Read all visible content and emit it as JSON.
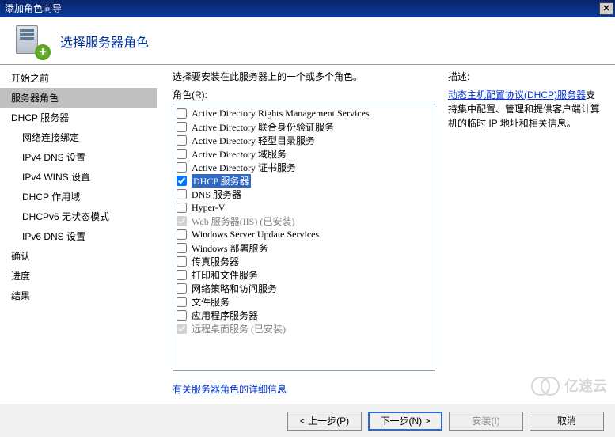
{
  "window": {
    "title": "添加角色向导"
  },
  "header": {
    "title": "选择服务器角色"
  },
  "sidebar": {
    "items": [
      {
        "label": "开始之前",
        "active": false,
        "sub": false
      },
      {
        "label": "服务器角色",
        "active": true,
        "sub": false
      },
      {
        "label": "DHCP 服务器",
        "active": false,
        "sub": false
      },
      {
        "label": "网络连接绑定",
        "active": false,
        "sub": true
      },
      {
        "label": "IPv4 DNS 设置",
        "active": false,
        "sub": true
      },
      {
        "label": "IPv4 WINS 设置",
        "active": false,
        "sub": true
      },
      {
        "label": "DHCP 作用域",
        "active": false,
        "sub": true
      },
      {
        "label": "DHCPv6 无状态模式",
        "active": false,
        "sub": true
      },
      {
        "label": "IPv6 DNS 设置",
        "active": false,
        "sub": true
      },
      {
        "label": "确认",
        "active": false,
        "sub": false
      },
      {
        "label": "进度",
        "active": false,
        "sub": false
      },
      {
        "label": "结果",
        "active": false,
        "sub": false
      }
    ]
  },
  "main": {
    "intro": "选择要安装在此服务器上的一个或多个角色。",
    "roles_label": "角色(R):",
    "roles": [
      {
        "label": "Active Directory Rights Management Services",
        "checked": false,
        "disabled": false,
        "selected": false
      },
      {
        "label": "Active Directory 联合身份验证服务",
        "checked": false,
        "disabled": false,
        "selected": false
      },
      {
        "label": "Active Directory 轻型目录服务",
        "checked": false,
        "disabled": false,
        "selected": false
      },
      {
        "label": "Active Directory 域服务",
        "checked": false,
        "disabled": false,
        "selected": false
      },
      {
        "label": "Active Directory 证书服务",
        "checked": false,
        "disabled": false,
        "selected": false
      },
      {
        "label": "DHCP 服务器",
        "checked": true,
        "disabled": false,
        "selected": true
      },
      {
        "label": "DNS 服务器",
        "checked": false,
        "disabled": false,
        "selected": false
      },
      {
        "label": "Hyper-V",
        "checked": false,
        "disabled": false,
        "selected": false
      },
      {
        "label": "Web 服务器(IIS)  (已安装)",
        "checked": true,
        "disabled": true,
        "selected": false
      },
      {
        "label": "Windows Server Update Services",
        "checked": false,
        "disabled": false,
        "selected": false
      },
      {
        "label": "Windows 部署服务",
        "checked": false,
        "disabled": false,
        "selected": false
      },
      {
        "label": "传真服务器",
        "checked": false,
        "disabled": false,
        "selected": false
      },
      {
        "label": "打印和文件服务",
        "checked": false,
        "disabled": false,
        "selected": false
      },
      {
        "label": "网络策略和访问服务",
        "checked": false,
        "disabled": false,
        "selected": false
      },
      {
        "label": "文件服务",
        "checked": false,
        "disabled": false,
        "selected": false
      },
      {
        "label": "应用程序服务器",
        "checked": false,
        "disabled": false,
        "selected": false
      },
      {
        "label": "远程桌面服务  (已安装)",
        "checked": true,
        "disabled": true,
        "selected": false
      }
    ],
    "more_info_link": "有关服务器角色的详细信息"
  },
  "right": {
    "desc_label": "描述:",
    "link_text": "动态主机配置协议(DHCP)服务器",
    "desc_rest": "支持集中配置、管理和提供客户端计算机的临时 IP 地址和相关信息。"
  },
  "footer": {
    "prev": "< 上一步(P)",
    "next": "下一步(N) >",
    "install": "安装(I)",
    "cancel": "取消"
  },
  "watermark": "亿速云"
}
